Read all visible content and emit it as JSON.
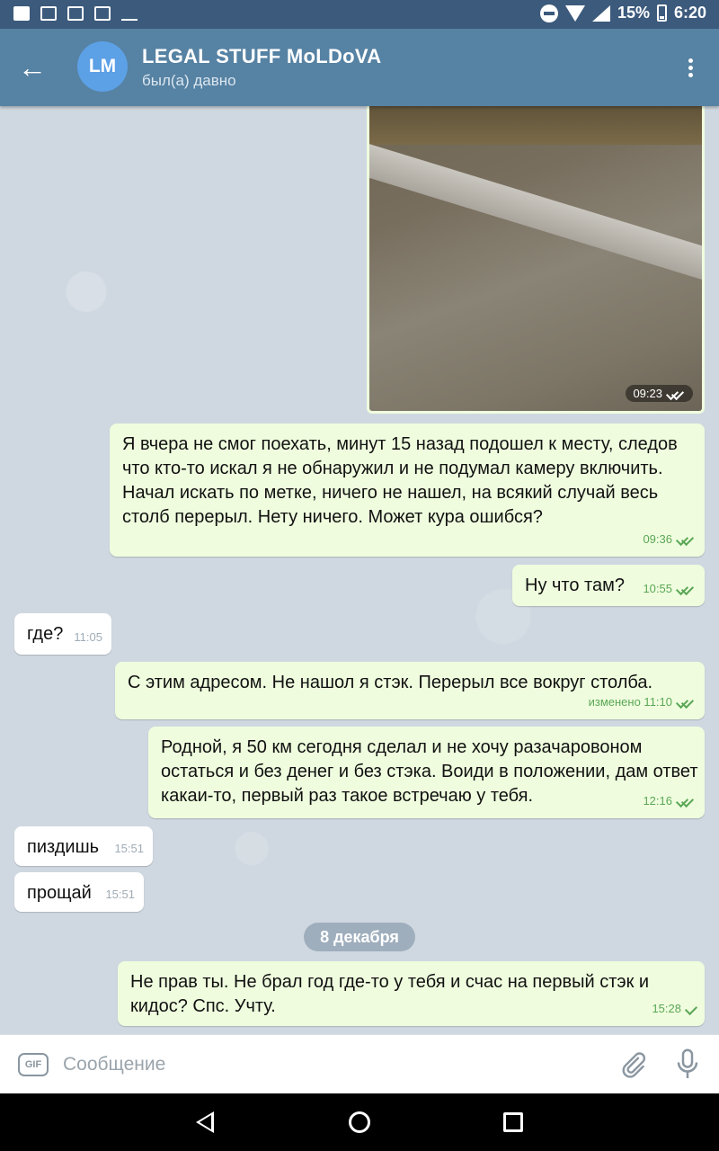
{
  "status_bar": {
    "battery": "15%",
    "time": "6:20",
    "notification_icons": [
      "facebook-icon",
      "alert-icon",
      "image-icon",
      "gmail-icon",
      "checklist-icon"
    ]
  },
  "header": {
    "avatar_initials": "LM",
    "title": "LEGAL STUFF MoLDoVA",
    "subtitle": "был(а) давно"
  },
  "photo_message": {
    "time": "09:23"
  },
  "messages": [
    {
      "direction": "out",
      "text": "Я вчера не смог поехать, минут 15 назад подошел к месту, следов что кто-то искал я не обнаружил и не подумал камеру включить. Начал искать по метке, ничего не нашел, на всякий случай весь столб перерыл. Нету ничего. Может кура ошибся?",
      "time": "09:36"
    },
    {
      "direction": "out",
      "text": "Ну что там?",
      "time": "10:55"
    },
    {
      "direction": "in",
      "text": "где?",
      "time": "11:05"
    },
    {
      "direction": "out",
      "text": "С этим адресом. Не нашол я стэк. Перерыл все вокруг столба.",
      "time": "изменено 11:10"
    },
    {
      "direction": "out",
      "text": "Родной, я 50 км сегодня сделал и не хочу разачаровоном остаться и без денег и без стэка. Воиди в положении, дам ответ какаи-то, первый раз такое встречаю у тебя.",
      "time": "12:16"
    },
    {
      "direction": "in",
      "text": "пиздишь",
      "time": "15:51"
    },
    {
      "direction": "in",
      "text": "прощай",
      "time": "15:51"
    },
    {
      "direction": "out",
      "text": "Не прав ты. Не брал год где-то у тебя и счас на первый стэк и кидос? Спс. Учту.",
      "time": "15:28"
    }
  ],
  "date_separator": "8 декабря",
  "composer": {
    "gif_label": "GIF",
    "placeholder": "Сообщение"
  },
  "colors": {
    "header": "#5682a3",
    "status_bar": "#3c5a7c",
    "outgoing_bubble": "#effdde",
    "incoming_bubble": "#ffffff",
    "check_color": "#5ba756"
  }
}
